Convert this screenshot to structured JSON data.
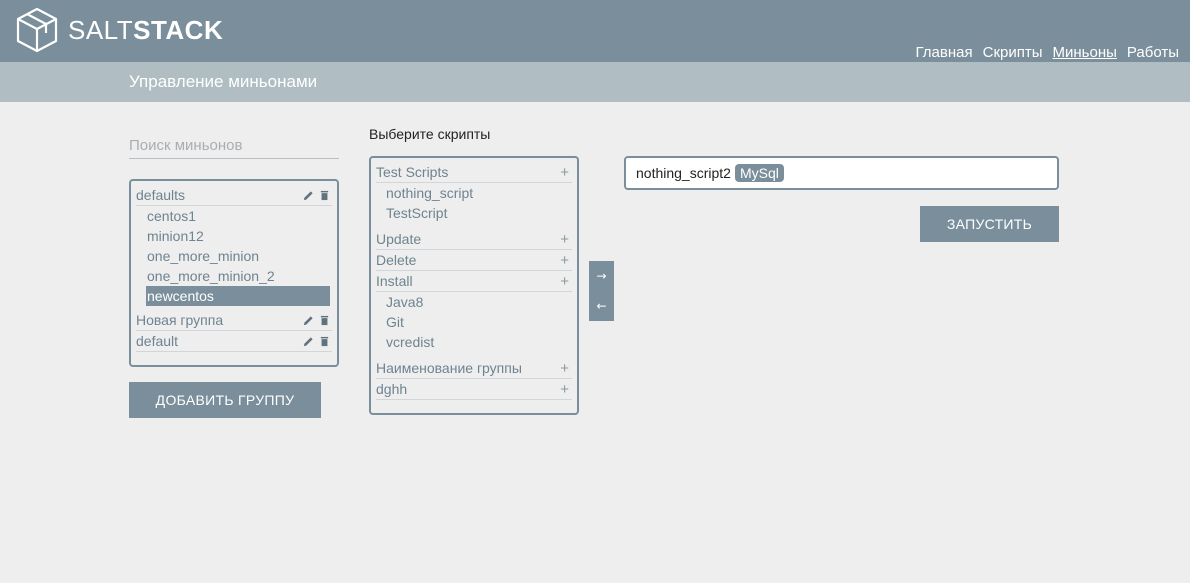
{
  "header": {
    "brand_light": "SALT",
    "brand_bold": "STACK",
    "nav": [
      {
        "label": "Главная",
        "active": false
      },
      {
        "label": "Скрипты",
        "active": false
      },
      {
        "label": "Миньоны",
        "active": true
      },
      {
        "label": "Работы",
        "active": false
      }
    ],
    "accent_color": "#7a8f9b"
  },
  "page": {
    "title": "Управление миньонами"
  },
  "minions": {
    "search_placeholder": "Поиск миньонов",
    "groups": [
      {
        "name": "defaults",
        "members": [
          "centos1",
          "minion12",
          "one_more_minion",
          "one_more_minion_2",
          "newcentos"
        ],
        "selected_member": "newcentos"
      },
      {
        "name": "Новая группа",
        "members": []
      },
      {
        "name": "default",
        "members": []
      }
    ],
    "add_group_label": "ДОБАВИТЬ ГРУППУ",
    "icons": {
      "edit": "pencil-icon",
      "delete": "trash-icon"
    }
  },
  "scripts": {
    "title": "Выберите скрипты",
    "groups": [
      {
        "name": "Test Scripts",
        "members": [
          "nothing_script",
          "TestScript"
        ]
      },
      {
        "name": "Update",
        "members": []
      },
      {
        "name": "Delete",
        "members": []
      },
      {
        "name": "Install",
        "members": [
          "Java8",
          "Git",
          "vcredist"
        ]
      },
      {
        "name": "Наименование группы",
        "members": []
      },
      {
        "name": "dghh",
        "members": []
      }
    ],
    "expand_symbol": "+"
  },
  "transfer": {
    "add_symbol": "→",
    "remove_symbol": "←"
  },
  "selection": {
    "script": "nothing_script2",
    "tag": "MySql"
  },
  "run_label": "ЗАПУСТИТЬ"
}
